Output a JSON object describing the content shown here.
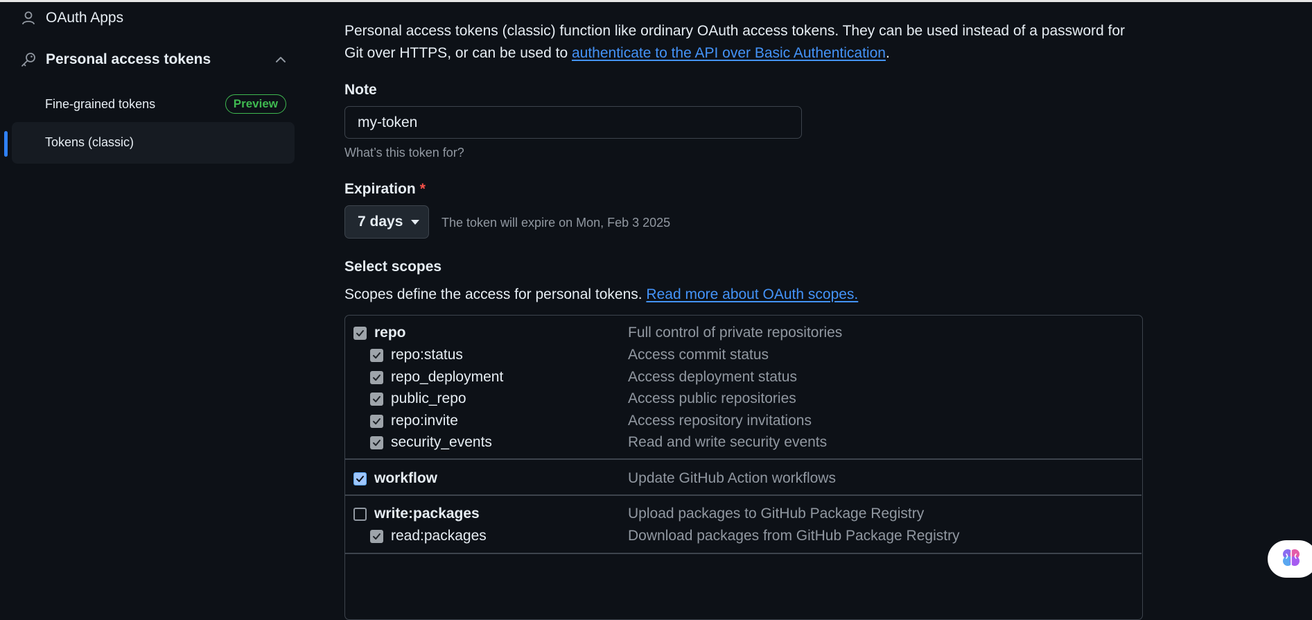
{
  "sidebar": {
    "oauth_apps": "OAuth Apps",
    "personal_access_tokens": "Personal access tokens",
    "fine_grained": "Fine-grained tokens",
    "preview_badge": "Preview",
    "tokens_classic": "Tokens (classic)"
  },
  "intro": {
    "text_before": "Personal access tokens (classic) function like ordinary OAuth access tokens. They can be used instead of a password for Git over HTTPS, or can be used to ",
    "link": "authenticate to the API over Basic Authentication",
    "text_after": "."
  },
  "note": {
    "label": "Note",
    "value": "my-token",
    "hint": "What’s this token for?"
  },
  "expiration": {
    "label": "Expiration",
    "required_mark": "*",
    "selected": "7 days",
    "note": "The token will expire on Mon, Feb 3 2025"
  },
  "scopes": {
    "title": "Select scopes",
    "desc_before": "Scopes define the access for personal tokens. ",
    "desc_link": "Read more about OAuth scopes.",
    "items": [
      {
        "name": "repo",
        "desc": "Full control of private repositories",
        "checked": true,
        "state": "grey"
      },
      {
        "name": "repo:status",
        "desc": "Access commit status",
        "checked": true,
        "state": "grey"
      },
      {
        "name": "repo_deployment",
        "desc": "Access deployment status",
        "checked": true,
        "state": "grey"
      },
      {
        "name": "public_repo",
        "desc": "Access public repositories",
        "checked": true,
        "state": "grey"
      },
      {
        "name": "repo:invite",
        "desc": "Access repository invitations",
        "checked": true,
        "state": "grey"
      },
      {
        "name": "security_events",
        "desc": "Read and write security events",
        "checked": true,
        "state": "grey"
      },
      {
        "name": "workflow",
        "desc": "Update GitHub Action workflows",
        "checked": true,
        "state": "blue"
      },
      {
        "name": "write:packages",
        "desc": "Upload packages to GitHub Package Registry",
        "checked": false,
        "state": "empty"
      },
      {
        "name": "read:packages",
        "desc": "Download packages from GitHub Package Registry",
        "checked": true,
        "state": "grey"
      }
    ]
  },
  "colors": {
    "background": "#0d1117",
    "link": "#4493f8",
    "badge": "#3fb950",
    "required": "#f85149",
    "active_bar": "#2f81f7"
  },
  "icons": [
    "person-icon",
    "key-icon",
    "chevron-up-icon",
    "caret-down-icon",
    "check-icon",
    "brain-icon"
  ]
}
